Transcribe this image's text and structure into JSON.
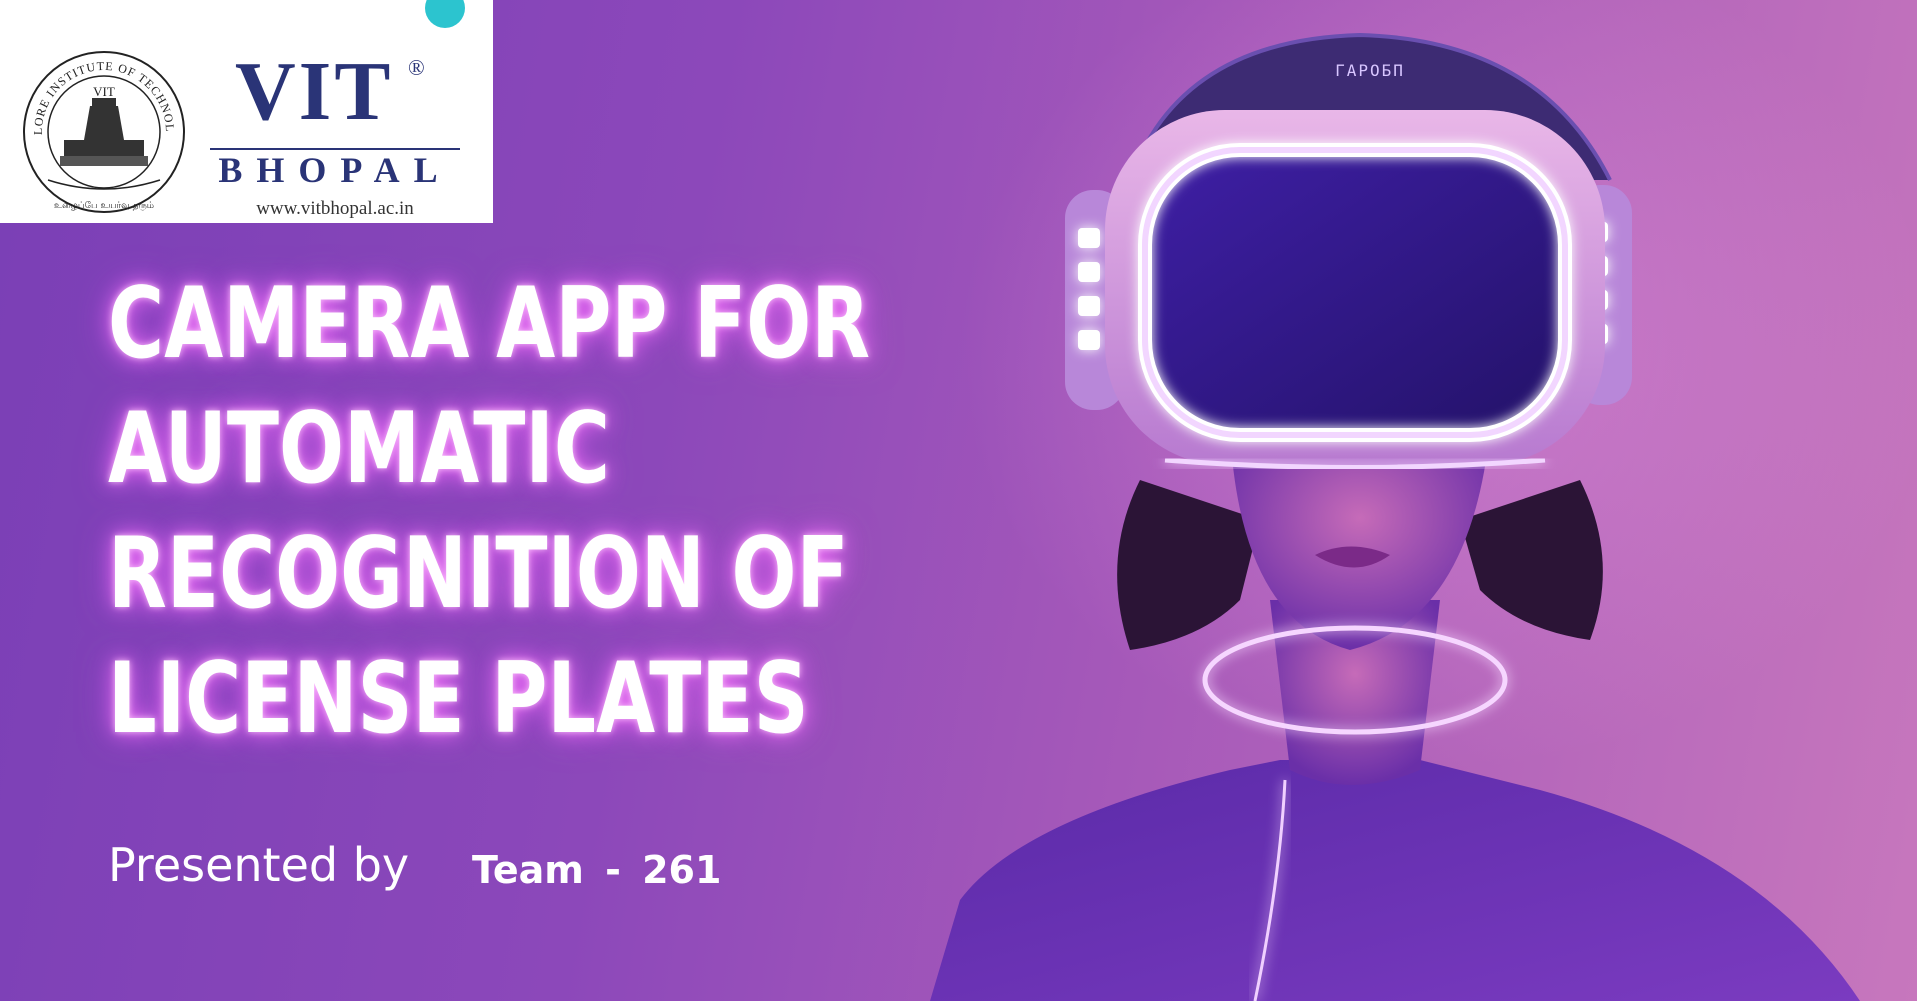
{
  "logo": {
    "seal_top_text": "VELLORE INSTITUTE OF TECHNOLOGY",
    "seal_center_text": "VIT",
    "seal_bottom_text": "உழைப்பே உயர்வு தரும்",
    "name": "VIT",
    "registered_mark": "®",
    "campus": "BHOPAL",
    "url": "www.vitbhopal.ac.in",
    "brand_color": "#2a3477",
    "accent_dot_color": "#2cc4cf"
  },
  "title": {
    "lines": [
      "CAMERA APP FOR",
      "AUTOMATIC",
      "RECOGNITION OF",
      "LICENSE PLATES"
    ]
  },
  "presented_by": "Presented by",
  "team": "Team - 261",
  "illustration": {
    "headset_label": "ГАРОБП",
    "description_icon": "vr-headset-person-illustration"
  },
  "colors": {
    "background_start": "#7a3fb6",
    "background_end": "#c777bd",
    "glow": "#e9c8ff"
  }
}
